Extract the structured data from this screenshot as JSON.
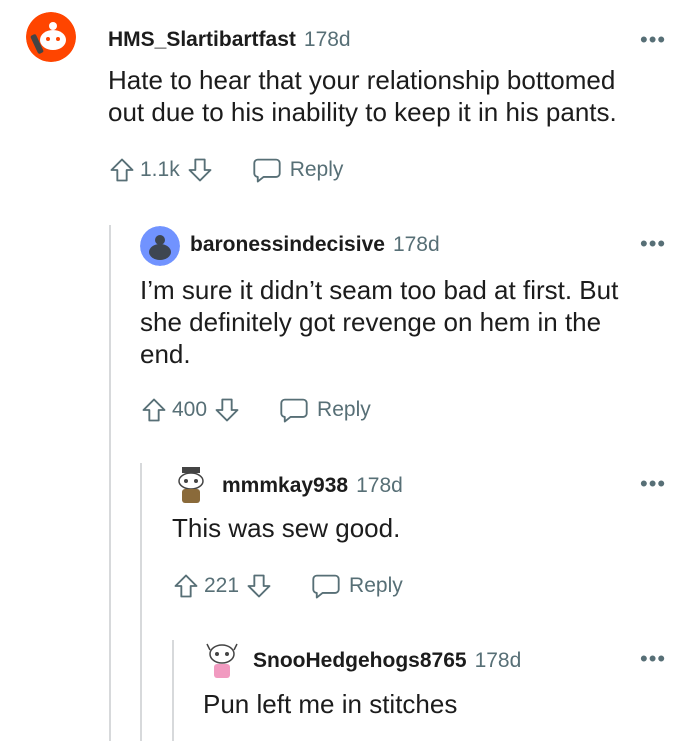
{
  "comments": [
    {
      "author": "HMS_Slartibartfast",
      "age": "178d",
      "more": "•••",
      "body": "Hate to hear that your relationship bottomed out due to his inability to keep it in his pants.",
      "votes": "1.1k",
      "reply_label": "Reply"
    },
    {
      "author": "baronessindecisive",
      "age": "178d",
      "more": "•••",
      "body": "I’m sure it didn’t seam too bad at first. But she definitely got revenge on hem in the end.",
      "votes": "400",
      "reply_label": "Reply"
    },
    {
      "author": "mmmkay938",
      "age": "178d",
      "more": "•••",
      "body": "This was sew good.",
      "votes": "221",
      "reply_label": "Reply"
    },
    {
      "author": "SnooHedgehogs8765",
      "age": "178d",
      "more": "•••",
      "body": "Pun left me in stitches"
    }
  ],
  "colors": {
    "text": "#1c1c1c",
    "meta": "#576f76",
    "thread": "#d7d9db",
    "avatar_orange": "#ff4500",
    "avatar_blue": "#7193ff"
  }
}
